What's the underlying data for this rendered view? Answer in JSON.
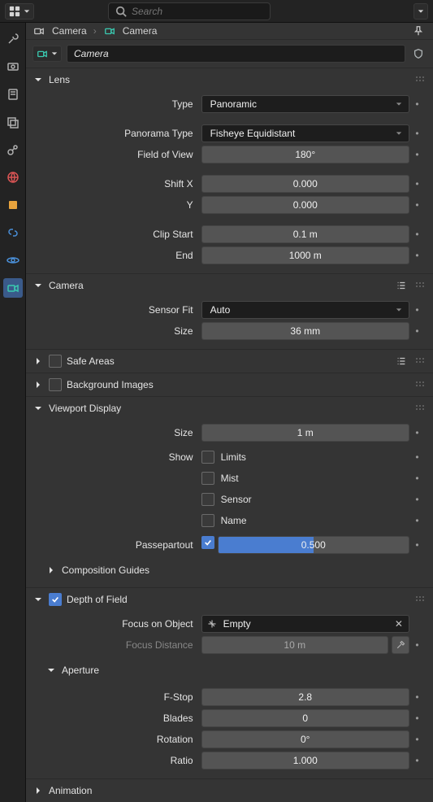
{
  "topbar": {
    "search_placeholder": "Search"
  },
  "breadcrumb": {
    "item1": "Camera",
    "item2": "Camera"
  },
  "datablock": {
    "name": "Camera"
  },
  "lens": {
    "title": "Lens",
    "type_label": "Type",
    "type_value": "Panoramic",
    "pano_type_label": "Panorama Type",
    "pano_type_value": "Fisheye Equidistant",
    "fov_label": "Field of View",
    "fov_value": "180°",
    "shiftx_label": "Shift X",
    "shiftx_value": "0.000",
    "shifty_label": "Y",
    "shifty_value": "0.000",
    "clipstart_label": "Clip Start",
    "clipstart_value": "0.1 m",
    "clipend_label": "End",
    "clipend_value": "1000 m"
  },
  "camera": {
    "title": "Camera",
    "sensorfit_label": "Sensor Fit",
    "sensorfit_value": "Auto",
    "size_label": "Size",
    "size_value": "36 mm"
  },
  "safe": {
    "title": "Safe Areas"
  },
  "bg": {
    "title": "Background Images"
  },
  "viewport": {
    "title": "Viewport Display",
    "size_label": "Size",
    "size_value": "1 m",
    "show_label": "Show",
    "limits": "Limits",
    "mist": "Mist",
    "sensor": "Sensor",
    "name": "Name",
    "passe_label": "Passepartout",
    "passe_value": "0.500",
    "comp_title": "Composition Guides"
  },
  "dof": {
    "title": "Depth of Field",
    "focusobj_label": "Focus on Object",
    "focusobj_value": "Empty",
    "focusdist_label": "Focus Distance",
    "focusdist_value": "10 m",
    "aperture_title": "Aperture",
    "fstop_label": "F-Stop",
    "fstop_value": "2.8",
    "blades_label": "Blades",
    "blades_value": "0",
    "rotation_label": "Rotation",
    "rotation_value": "0°",
    "ratio_label": "Ratio",
    "ratio_value": "1.000"
  },
  "anim": {
    "title": "Animation"
  }
}
